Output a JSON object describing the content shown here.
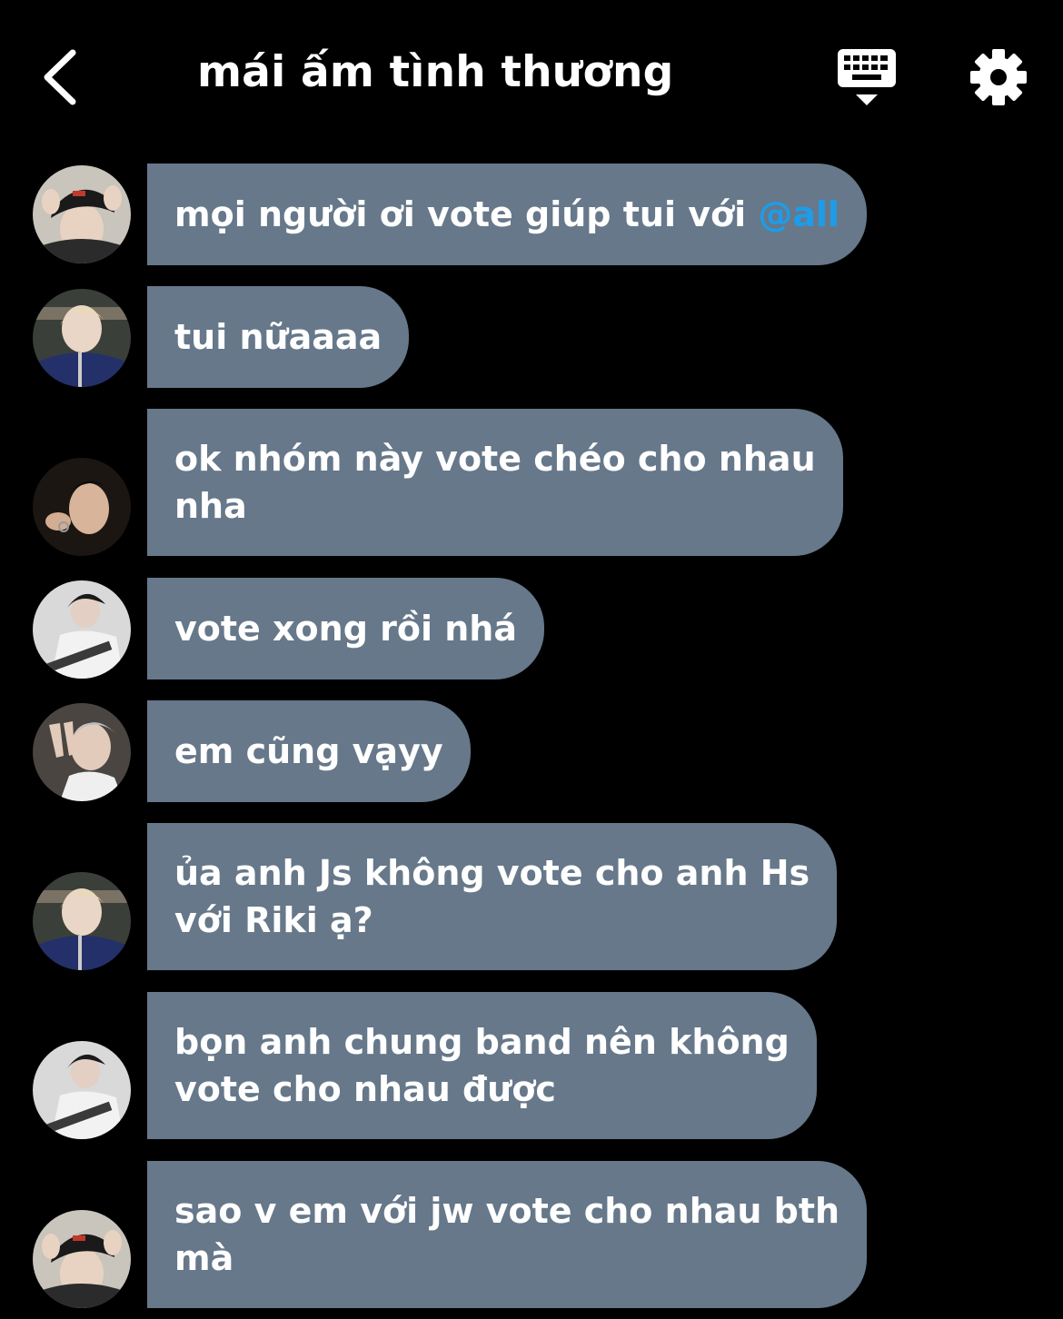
{
  "header": {
    "title": "mái ấm tình thương",
    "back_icon": "chevron-left-icon",
    "keyboard_icon": "keyboard-hide-icon",
    "settings_icon": "gear-icon"
  },
  "colors": {
    "background": "#000000",
    "bubble": "#66788a",
    "mention": "#1e9ce8"
  },
  "messages": [
    {
      "text": "mọi người ơi vote giúp tui với ",
      "mention": "@all",
      "avatar": "avatar-cap-boy"
    },
    {
      "text": "tui nữaaaa",
      "avatar": "avatar-blonde-boy"
    },
    {
      "text": "ok nhóm này vote chéo cho nhau\nnha",
      "avatar": "avatar-dark-hair-boy"
    },
    {
      "text": "vote xong rồi nhá",
      "avatar": "avatar-guitar-boy"
    },
    {
      "text": "em cũng vạyy",
      "avatar": "avatar-peace-sign-boy"
    },
    {
      "text": "ủa anh Js không vote cho anh Hs\nvới Riki ạ?",
      "avatar": "avatar-blonde-boy"
    },
    {
      "text": "bọn anh chung band nên không\nvote cho nhau được",
      "avatar": "avatar-guitar-boy"
    },
    {
      "text": "sao v em với jw vote cho nhau bth\nmà",
      "avatar": "avatar-cap-boy"
    }
  ]
}
